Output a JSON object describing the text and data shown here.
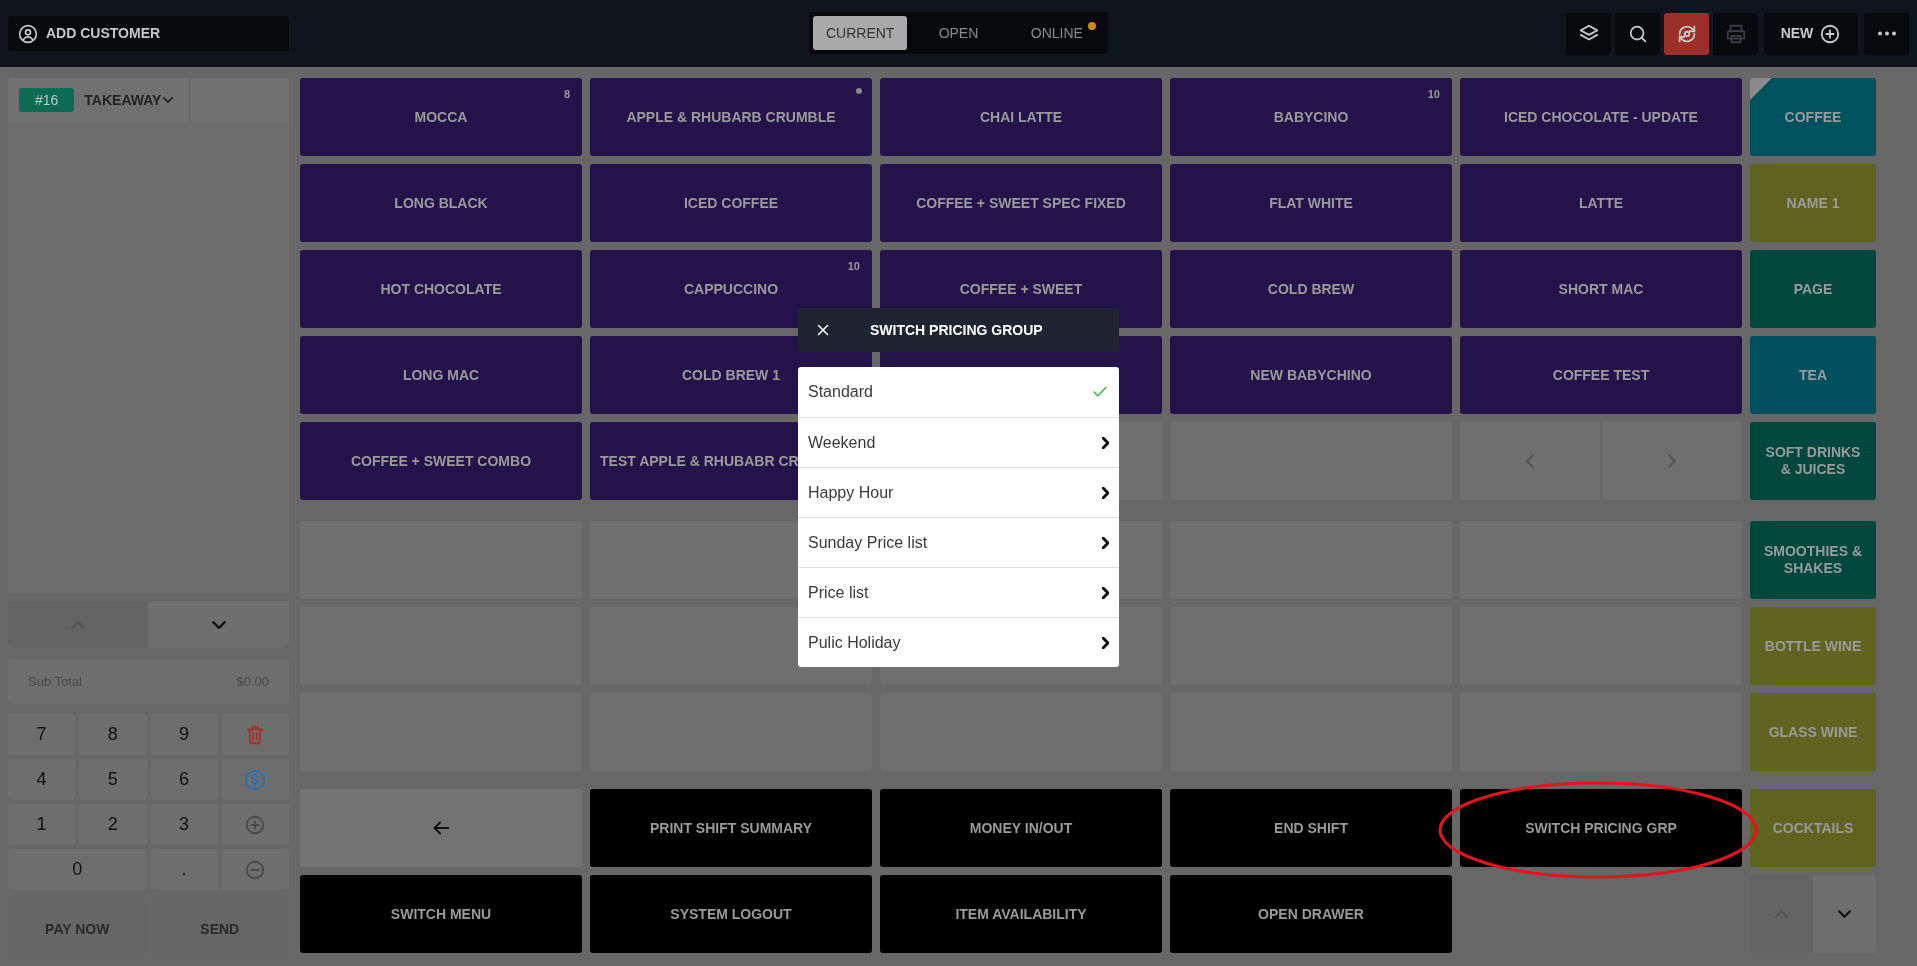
{
  "top_bar": {
    "customer_button": "ADD CUSTOMER",
    "tabs": [
      {
        "label": "CURRENT",
        "selected": true,
        "alert": false
      },
      {
        "label": "OPEN",
        "selected": false,
        "alert": false
      },
      {
        "label": "ONLINE",
        "selected": false,
        "alert": true
      }
    ],
    "tools": [
      {
        "kind": "layers",
        "disabled": false
      },
      {
        "kind": "search",
        "disabled": false
      },
      {
        "kind": "sync",
        "disabled": false
      },
      {
        "kind": "print",
        "disabled": true
      },
      {
        "kind": "new",
        "label": "NEW",
        "disabled": false
      },
      {
        "kind": "more",
        "disabled": false
      }
    ]
  },
  "order": {
    "number": "#16",
    "type": "TAKEAWAY",
    "subtotal_label": "Sub Total",
    "subtotal_value": "$0.00",
    "keys": [
      {
        "kind": "digit",
        "label": "7"
      },
      {
        "kind": "digit",
        "label": "8"
      },
      {
        "kind": "digit",
        "label": "9"
      },
      {
        "kind": "delete"
      },
      {
        "kind": "digit",
        "label": "4"
      },
      {
        "kind": "digit",
        "label": "5"
      },
      {
        "kind": "digit",
        "label": "6"
      },
      {
        "kind": "cash"
      },
      {
        "kind": "digit",
        "label": "1"
      },
      {
        "kind": "digit",
        "label": "2"
      },
      {
        "kind": "digit",
        "label": "3"
      },
      {
        "kind": "increase"
      },
      {
        "kind": "digit_wide",
        "label": "0"
      },
      {
        "kind": "digit",
        "label": "."
      },
      {
        "kind": "decrease"
      }
    ],
    "buttons": [
      "PAY NOW",
      "SEND"
    ]
  },
  "products": [
    {
      "kind": "product",
      "label": "MOCCA",
      "badge": "8"
    },
    {
      "kind": "product",
      "label": "APPLE & RHUBARB CRUMBLE",
      "dot": true
    },
    {
      "kind": "product",
      "label": "CHAI LATTE"
    },
    {
      "kind": "product",
      "label": "BABYCINO",
      "badge": "10"
    },
    {
      "kind": "product",
      "label": "ICED CHOCOLATE - UPDATE"
    },
    {
      "kind": "product",
      "label": "LONG BLACK"
    },
    {
      "kind": "product",
      "label": "ICED COFFEE"
    },
    {
      "kind": "product",
      "label": "COFFEE + SWEET SPEC FIXED"
    },
    {
      "kind": "product",
      "label": "FLAT WHITE"
    },
    {
      "kind": "product",
      "label": "LATTE"
    },
    {
      "kind": "product",
      "label": "HOT CHOCOLATE"
    },
    {
      "kind": "product",
      "label": "CAPPUCCINO",
      "badge": "10"
    },
    {
      "kind": "product",
      "label": "COFFEE + SWEET"
    },
    {
      "kind": "product",
      "label": "COLD BREW"
    },
    {
      "kind": "product",
      "label": "SHORT MAC"
    },
    {
      "kind": "product",
      "label": "LONG MAC"
    },
    {
      "kind": "product",
      "label": "COLD BREW 1"
    },
    {
      "kind": "covered"
    },
    {
      "kind": "product",
      "label": "NEW BABYCHINO"
    },
    {
      "kind": "product",
      "label": "COFFEE TEST"
    },
    {
      "kind": "product",
      "label": "COFFEE + SWEET COMBO"
    },
    {
      "kind": "partly_covered",
      "label": "TEST APPLE & RHUBABR CR"
    },
    {
      "kind": "empty"
    },
    {
      "kind": "empty"
    },
    {
      "kind": "pager"
    }
  ],
  "actions": [
    {
      "kind": "back"
    },
    {
      "kind": "command",
      "label": "PRINT SHIFT SUMMARY"
    },
    {
      "kind": "command",
      "label": "MONEY IN/OUT"
    },
    {
      "kind": "command",
      "label": "END SHIFT"
    },
    {
      "kind": "command",
      "label": "SWITCH PRICING GRP"
    },
    {
      "kind": "command",
      "label": "SWITCH MENU"
    },
    {
      "kind": "command",
      "label": "SYSTEM LOGOUT"
    },
    {
      "kind": "command",
      "label": "ITEM AVAILABILITY"
    },
    {
      "kind": "command",
      "label": "OPEN DRAWER"
    }
  ],
  "categories": [
    {
      "label": "COFFEE",
      "color": "#00525e",
      "selected": true
    },
    {
      "label": "NAME 1",
      "color": "#5f6320",
      "selected": false
    },
    {
      "label": "PAGE",
      "color": "#00473e",
      "selected": false
    },
    {
      "label": "TEA",
      "color": "#005060",
      "selected": false
    },
    {
      "label": "SOFT DRINKS & JUICES",
      "color": "#00473e",
      "selected": false
    },
    {
      "label": "SMOOTHIES & SHAKES",
      "color": "#00473e",
      "selected": false
    },
    {
      "label": "BOTTLE WINE",
      "color": "#5f6420",
      "selected": false
    },
    {
      "label": "GLASS WINE",
      "color": "#5f6420",
      "selected": false
    },
    {
      "label": "COCKTAILS",
      "color": "#5f6320",
      "selected": false
    }
  ],
  "dialog": {
    "title": "SWITCH PRICING GROUP",
    "options": [
      {
        "label": "Standard",
        "selected": true
      },
      {
        "label": "Weekend",
        "selected": false
      },
      {
        "label": "Happy Hour",
        "selected": false
      },
      {
        "label": "Sunday Price list",
        "selected": false
      },
      {
        "label": "Price list",
        "selected": false
      },
      {
        "label": "Pulic Holiday",
        "selected": false
      }
    ]
  }
}
